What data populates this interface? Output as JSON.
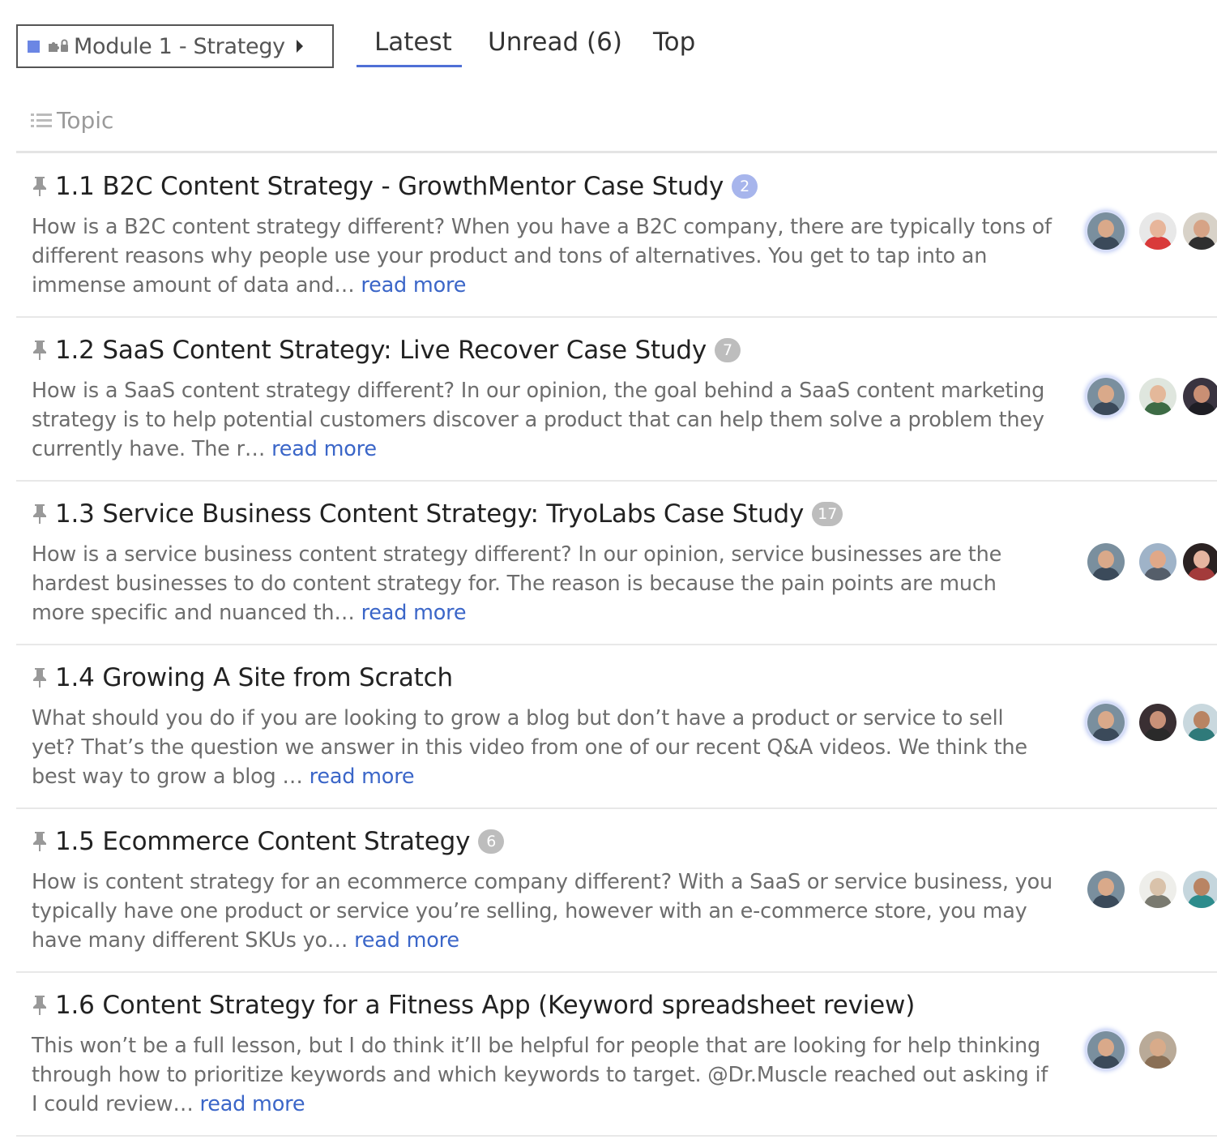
{
  "nav": {
    "category": "Module 1 - Strategy",
    "tabs": [
      {
        "label": "Latest",
        "active": true
      },
      {
        "label": "Unread (6)",
        "active": false
      },
      {
        "label": "Top",
        "active": false
      }
    ],
    "accent_color": "#4f6fd6"
  },
  "list_header": {
    "column": "Topic"
  },
  "topics": [
    {
      "title": "1.1 B2C Content Strategy - GrowthMentor Case Study",
      "count": "2",
      "count_style": "new",
      "excerpt": "How is a B2C content strategy different? When you have a B2C company, there are typically tons of different reasons why people use your product and tons of alternatives. You get to tap into an immense amount of data and…",
      "read_more": "read more"
    },
    {
      "title": "1.2 SaaS Content Strategy: Live Recover Case Study",
      "count": "7",
      "count_style": "old",
      "excerpt": "How is a SaaS content strategy different? In our opinion, the goal behind a SaaS content marketing strategy is to help potential customers discover a product that can help them solve a problem they currently have. The r…",
      "read_more": "read more"
    },
    {
      "title": "1.3 Service Business Content Strategy: TryoLabs Case Study",
      "count": "17",
      "count_style": "old",
      "excerpt": "How is a service business content strategy different? In our opinion, service businesses are the hardest businesses to do content strategy for. The reason is because the pain points are much more specific and nuanced th…",
      "read_more": "read more"
    },
    {
      "title": "1.4 Growing A Site from Scratch",
      "count": "",
      "count_style": "none",
      "excerpt": "What should you do if you are looking to grow a blog but don’t have a product or service to sell yet? That’s the question we answer in this video from one of our recent Q&A videos. We think the best way to grow a blog …",
      "read_more": "read more"
    },
    {
      "title": "1.5 Ecommerce Content Strategy",
      "count": "6",
      "count_style": "old",
      "excerpt": "How is content strategy for an ecommerce company different? With a SaaS or service business, you typically have one product or service you’re selling, however with an e-commerce store, you may have many different SKUs yo…",
      "read_more": "read more"
    },
    {
      "title": "1.6 Content Strategy for a Fitness App (Keyword spreadsheet review)",
      "count": "",
      "count_style": "none",
      "excerpt": "This won’t be a full lesson, but I do think it’ll be helpful for people that are looking for help thinking through how to prioritize keywords and which keywords to target. @Dr.Muscle reached out asking if I could review…",
      "read_more": "read more"
    }
  ],
  "avatar_colors": {
    "topic_1": [
      {
        "bg": "#7a8f9e",
        "face": "#d9a98a",
        "body": "#3b4a5a",
        "latest": true
      },
      {
        "bg": "#e8e8e8",
        "face": "#e7b59a",
        "body": "#d93a3a",
        "latest": false
      },
      {
        "bg": "#d8d2c8",
        "face": "#d6a386",
        "body": "#2f2f2f",
        "latest": false
      }
    ],
    "topic_2": [
      {
        "bg": "#7a8f9e",
        "face": "#d9a98a",
        "body": "#3b4a5a",
        "latest": true
      },
      {
        "bg": "#dfe6de",
        "face": "#e4b89a",
        "body": "#3d6b45",
        "latest": false
      },
      {
        "bg": "#3a3440",
        "face": "#c98f74",
        "body": "#1e1e24",
        "latest": false
      }
    ],
    "topic_3": [
      {
        "bg": "#7a8f9e",
        "face": "#d9a98a",
        "body": "#3b4a5a",
        "latest": false
      },
      {
        "bg": "#9fb3c8",
        "face": "#e0a888",
        "body": "#555e6a",
        "latest": false
      },
      {
        "bg": "#2b2222",
        "face": "#e6b5a0",
        "body": "#a33b3b",
        "latest": false
      }
    ],
    "topic_4": [
      {
        "bg": "#7a8f9e",
        "face": "#d9a98a",
        "body": "#3b4a5a",
        "latest": true
      },
      {
        "bg": "#3a2f33",
        "face": "#c99178",
        "body": "#2a2a2a",
        "latest": false
      },
      {
        "bg": "#c9d8de",
        "face": "#b98463",
        "body": "#2f7a7a",
        "latest": false
      }
    ],
    "topic_5": [
      {
        "bg": "#7a8f9e",
        "face": "#d9a98a",
        "body": "#3b4a5a",
        "latest": false
      },
      {
        "bg": "#eeeeea",
        "face": "#d9c2aa",
        "body": "#7a7a70",
        "latest": false
      },
      {
        "bg": "#c5d6dd",
        "face": "#b98463",
        "body": "#2d8c8c",
        "latest": false
      }
    ],
    "topic_6": [
      {
        "bg": "#7a8f9e",
        "face": "#d9a98a",
        "body": "#3b4a5a",
        "latest": true
      },
      {
        "bg": "#b9aa98",
        "face": "#d8ab8a",
        "body": "#8a6f55",
        "latest": false
      }
    ]
  }
}
